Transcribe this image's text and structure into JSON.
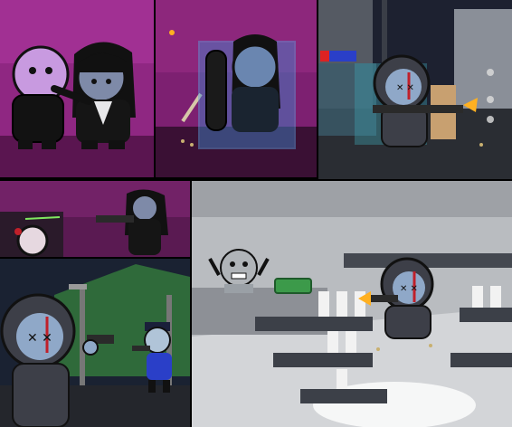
{
  "collage": {
    "panels": [
      {
        "id": "p1",
        "scene": "nightclub-melee"
      },
      {
        "id": "p2",
        "scene": "riot-shield-blocker"
      },
      {
        "id": "p3",
        "scene": "street-shotgun"
      },
      {
        "id": "p4",
        "scene": "hallway-gunman"
      },
      {
        "id": "p5",
        "scene": "night-police-standoff"
      },
      {
        "id": "p6",
        "scene": "store-robbery"
      }
    ],
    "colors": {
      "club_magenta": "#9b2a8c",
      "club_dark": "#3a1034",
      "hoodie_gray": "#3d3f48",
      "skin_blue": "#8fa8c8",
      "blood_red": "#c0202a",
      "muzzle_flash": "#ffb020",
      "cash_green": "#3c9a4a",
      "police_blue": "#2a3fc8",
      "store_gray": "#c7c9cc"
    }
  }
}
